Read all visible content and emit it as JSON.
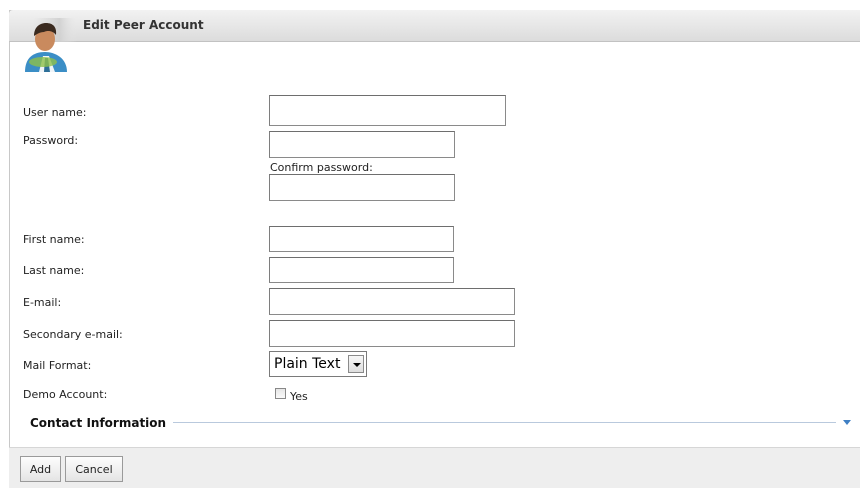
{
  "header": {
    "title": "Edit Peer Account"
  },
  "form": {
    "username_label": "User name:",
    "password_label": "Password:",
    "confirm_password_label": "Confirm password:",
    "first_name_label": "First name:",
    "last_name_label": "Last name:",
    "email_label": "E-mail:",
    "secondary_email_label": "Secondary e-mail:",
    "mail_format_label": "Mail Format:",
    "mail_format_value": "Plain Text",
    "demo_account_label": "Demo Account:",
    "demo_yes_label": "Yes",
    "username_value": "",
    "password_value": "",
    "confirm_password_value": "",
    "first_name_value": "",
    "last_name_value": "",
    "email_value": "",
    "secondary_email_value": ""
  },
  "section": {
    "contact_information": "Contact Information"
  },
  "footer": {
    "add_label": "Add",
    "cancel_label": "Cancel"
  }
}
